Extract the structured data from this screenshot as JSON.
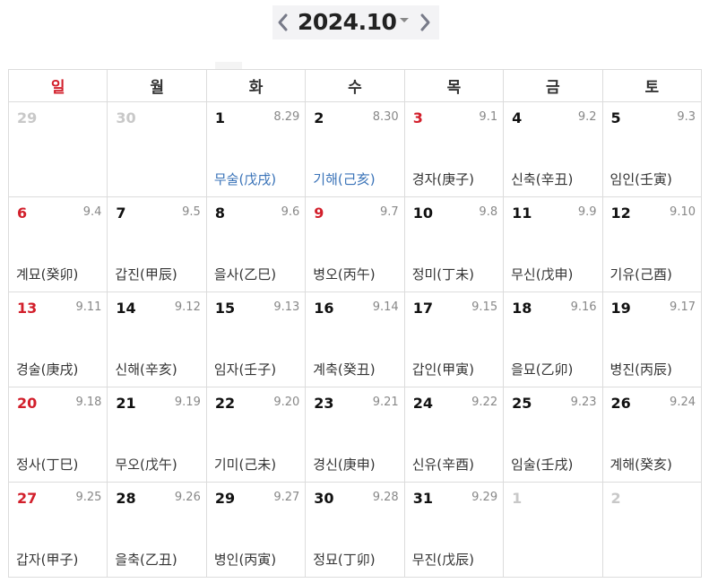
{
  "header": {
    "prev_icon": "chevron-left-icon",
    "next_icon": "chevron-right-icon",
    "month_label": "2024.10",
    "dropdown_icon": "caret-down-icon"
  },
  "colors": {
    "sunday": "#d21f2b",
    "highlight_ganji": "#3a73b8",
    "other_month": "#c8c8c8",
    "lunar": "#888888"
  },
  "weekdays": [
    "일",
    "월",
    "화",
    "수",
    "목",
    "금",
    "토"
  ],
  "weeks": [
    [
      {
        "day": "29",
        "lunar": "",
        "ganji": "",
        "other": true
      },
      {
        "day": "30",
        "lunar": "",
        "ganji": "",
        "other": true
      },
      {
        "day": "1",
        "lunar": "8.29",
        "ganji": "무술(戊戌)",
        "blue": true
      },
      {
        "day": "2",
        "lunar": "8.30",
        "ganji": "기해(己亥)",
        "blue": true
      },
      {
        "day": "3",
        "lunar": "9.1",
        "ganji": "경자(庚子)",
        "red": true
      },
      {
        "day": "4",
        "lunar": "9.2",
        "ganji": "신축(辛丑)"
      },
      {
        "day": "5",
        "lunar": "9.3",
        "ganji": "임인(壬寅)"
      }
    ],
    [
      {
        "day": "6",
        "lunar": "9.4",
        "ganji": "계묘(癸卯)"
      },
      {
        "day": "7",
        "lunar": "9.5",
        "ganji": "갑진(甲辰)"
      },
      {
        "day": "8",
        "lunar": "9.6",
        "ganji": "을사(乙巳)"
      },
      {
        "day": "9",
        "lunar": "9.7",
        "ganji": "병오(丙午)",
        "red": true
      },
      {
        "day": "10",
        "lunar": "9.8",
        "ganji": "정미(丁未)"
      },
      {
        "day": "11",
        "lunar": "9.9",
        "ganji": "무신(戊申)"
      },
      {
        "day": "12",
        "lunar": "9.10",
        "ganji": "기유(己酉)"
      }
    ],
    [
      {
        "day": "13",
        "lunar": "9.11",
        "ganji": "경술(庚戌)"
      },
      {
        "day": "14",
        "lunar": "9.12",
        "ganji": "신해(辛亥)"
      },
      {
        "day": "15",
        "lunar": "9.13",
        "ganji": "임자(壬子)"
      },
      {
        "day": "16",
        "lunar": "9.14",
        "ganji": "계축(癸丑)"
      },
      {
        "day": "17",
        "lunar": "9.15",
        "ganji": "갑인(甲寅)"
      },
      {
        "day": "18",
        "lunar": "9.16",
        "ganji": "을묘(乙卯)"
      },
      {
        "day": "19",
        "lunar": "9.17",
        "ganji": "병진(丙辰)"
      }
    ],
    [
      {
        "day": "20",
        "lunar": "9.18",
        "ganji": "정사(丁巳)"
      },
      {
        "day": "21",
        "lunar": "9.19",
        "ganji": "무오(戊午)"
      },
      {
        "day": "22",
        "lunar": "9.20",
        "ganji": "기미(己未)"
      },
      {
        "day": "23",
        "lunar": "9.21",
        "ganji": "경신(庚申)"
      },
      {
        "day": "24",
        "lunar": "9.22",
        "ganji": "신유(辛酉)"
      },
      {
        "day": "25",
        "lunar": "9.23",
        "ganji": "임술(壬戌)"
      },
      {
        "day": "26",
        "lunar": "9.24",
        "ganji": "계해(癸亥)"
      }
    ],
    [
      {
        "day": "27",
        "lunar": "9.25",
        "ganji": "갑자(甲子)"
      },
      {
        "day": "28",
        "lunar": "9.26",
        "ganji": "을축(乙丑)"
      },
      {
        "day": "29",
        "lunar": "9.27",
        "ganji": "병인(丙寅)"
      },
      {
        "day": "30",
        "lunar": "9.28",
        "ganji": "정묘(丁卯)"
      },
      {
        "day": "31",
        "lunar": "9.29",
        "ganji": "무진(戊辰)"
      },
      {
        "day": "1",
        "lunar": "",
        "ganji": "",
        "other": true
      },
      {
        "day": "2",
        "lunar": "",
        "ganji": "",
        "other": true
      }
    ]
  ]
}
